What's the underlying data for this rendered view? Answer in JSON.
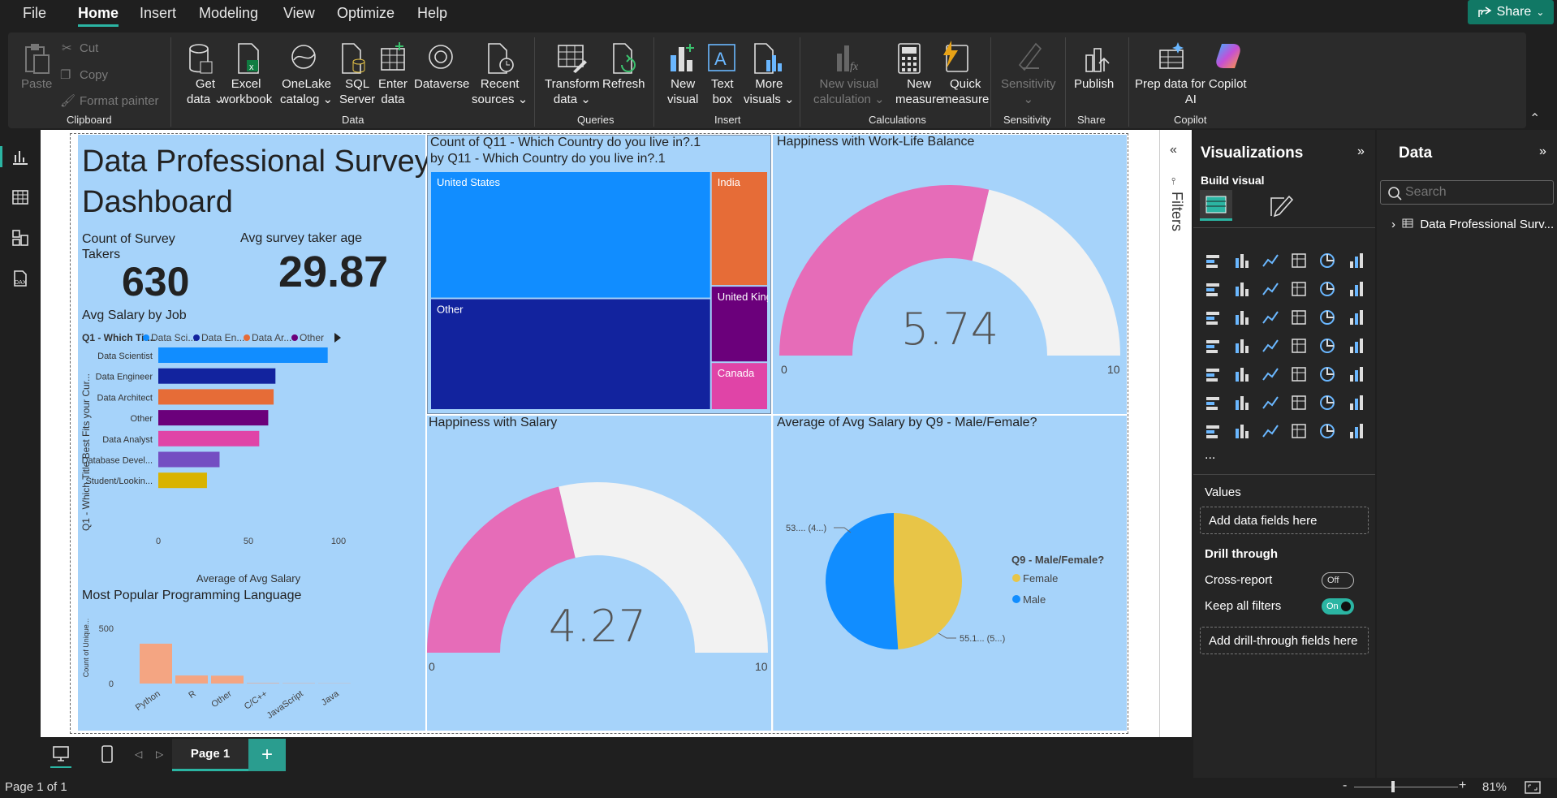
{
  "menu": {
    "file": "File",
    "home": "Home",
    "insert": "Insert",
    "modeling": "Modeling",
    "view": "View",
    "optimize": "Optimize",
    "help": "Help",
    "share": "Share"
  },
  "ribbon": {
    "paste": "Paste",
    "cut": "Cut",
    "copy": "Copy",
    "format_painter": "Format painter",
    "get_data": [
      "Get",
      "data"
    ],
    "excel": [
      "Excel",
      "workbook"
    ],
    "onelake": [
      "OneLake",
      "catalog"
    ],
    "sql": [
      "SQL",
      "Server"
    ],
    "enter_data": [
      "Enter",
      "data"
    ],
    "dataverse": "Dataverse",
    "recent": [
      "Recent",
      "sources"
    ],
    "transform": [
      "Transform",
      "data"
    ],
    "refresh": "Refresh",
    "new_visual": [
      "New",
      "visual"
    ],
    "text_box": [
      "Text",
      "box"
    ],
    "more_visuals": [
      "More",
      "visuals"
    ],
    "new_visual_calc": [
      "New visual",
      "calculation"
    ],
    "new_measure": [
      "New",
      "measure"
    ],
    "quick_measure": [
      "Quick",
      "measure"
    ],
    "sensitivity": "Sensitivity",
    "publish": "Publish",
    "prep_data": [
      "Prep data for Copilot",
      "AI"
    ],
    "groups": {
      "clipboard": "Clipboard",
      "data": "Data",
      "queries": "Queries",
      "insert": "Insert",
      "calculations": "Calculations",
      "sensitivity": "Sensitivity",
      "share": "Share",
      "copilot": "Copilot"
    }
  },
  "report": {
    "title": [
      "Data Professional Survey",
      "Dashboard"
    ],
    "card1": {
      "label": [
        "Count of Survey",
        "Takers"
      ],
      "value": "630"
    },
    "card2": {
      "label": "Avg survey taker age",
      "value": "29.87"
    },
    "salary_title": "Avg Salary by Job",
    "treemap_title": [
      "Count of Q11 - Which Country do you live in?.1",
      "by Q11 - Which Country do you live in?.1"
    ],
    "gauge1_title": "Happiness with Work-Life Balance",
    "gauge2_title": "Happiness with Salary",
    "pie_title": "Average of Avg Salary by Q9 - Male/Female?",
    "prog_title": "Most Popular Programming Language"
  },
  "chart_data": [
    {
      "type": "bar",
      "title": "Avg Salary by Job",
      "legend_title": "Q1 - Which Tit...",
      "legend": [
        "Data Sci...",
        "Data En...",
        "Data Ar...",
        "Other"
      ],
      "legend_colors": [
        "#118dff",
        "#12239e",
        "#e66c37",
        "#6b007b"
      ],
      "categories": [
        "Data Scientist",
        "Data Engineer",
        "Data Architect",
        "Other",
        "Data Analyst",
        "Database Devel...",
        "Student/Lookin..."
      ],
      "values": [
        94,
        65,
        64,
        61,
        56,
        34,
        27
      ],
      "colors": [
        "#118dff",
        "#12239e",
        "#e66c37",
        "#6b007b",
        "#e044a7",
        "#744ec2",
        "#d9b300"
      ],
      "xlabel": "Average of Avg Salary",
      "ylabel": "Q1 - Which Title Best Fits your Cur...",
      "xticks": [
        "0",
        "50",
        "100"
      ],
      "xlim": [
        0,
        100
      ]
    },
    {
      "type": "treemap",
      "title": "Count of Q11 - Which Country do you live in?.1 by Q11 - Which Country do you live in?.1",
      "categories": [
        "United States",
        "Other",
        "India",
        "United King...",
        "Canada"
      ],
      "values": [
        262,
        230,
        48,
        32,
        20
      ],
      "colors": [
        "#118dff",
        "#12239e",
        "#e66c37",
        "#6b007b",
        "#e044a7"
      ]
    },
    {
      "type": "gauge",
      "title": "Happiness with Work-Life Balance",
      "value": 5.74,
      "value_label": "5.74",
      "min": 0,
      "max": 10,
      "min_label": "0",
      "max_label": "10"
    },
    {
      "type": "gauge",
      "title": "Happiness with Salary",
      "value": 4.27,
      "value_label": "4.27",
      "min": 0,
      "max": 10,
      "min_label": "0",
      "max_label": "10"
    },
    {
      "type": "pie",
      "title": "Average of Avg Salary by Q9 - Male/Female?",
      "legend_title": "Q9 - Male/Female?",
      "categories": [
        "Female",
        "Male"
      ],
      "values": [
        49,
        51
      ],
      "labels": [
        "53.... (4...)",
        "55.1... (5...)"
      ],
      "colors": [
        "#e8c547",
        "#118dff"
      ]
    },
    {
      "type": "bar",
      "title": "Most Popular Programming Language",
      "ylabel": "Count of Unique...",
      "yticks": [
        "500",
        "0"
      ],
      "ylim": [
        0,
        600
      ],
      "categories": [
        "Python",
        "R",
        "Other",
        "C/C++",
        "JavaScript",
        "Java"
      ],
      "values": [
        421,
        85,
        83,
        5,
        3,
        2
      ],
      "color": "#f4a582"
    }
  ],
  "filters": {
    "label": "Filters"
  },
  "viz": {
    "title": "Visualizations",
    "build": "Build visual",
    "values": "Values",
    "add_values": "Add data fields here",
    "drill": "Drill through",
    "cross": "Cross-report",
    "cross_state": "Off",
    "keep": "Keep all filters",
    "keep_state": "On",
    "add_drill": "Add drill-through fields here",
    "more": "..."
  },
  "data_pane": {
    "title": "Data",
    "search_placeholder": "Search",
    "table": "Data Professional Surv..."
  },
  "tabs": {
    "page1": "Page 1",
    "add": "+"
  },
  "status": {
    "page": "Page 1 of 1",
    "zoom": "81%",
    "minus": "-",
    "plus": "+"
  }
}
